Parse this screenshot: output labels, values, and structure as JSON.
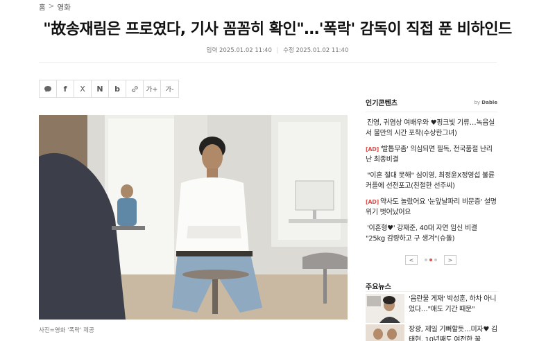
{
  "breadcrumb": {
    "home": "홈",
    "sep": ">",
    "section": "영화"
  },
  "headline": "\"故송재림은 프로였다, 기사 꼼꼼히 확인\"…'폭락' 감독이 직접 푼 비하인드",
  "meta": {
    "input": "입력 2025.01.02 11:40",
    "divider": "|",
    "updated": "수정 2025.01.02 11:40"
  },
  "share": {
    "comment_icon": "speech-bubble",
    "facebook": "f",
    "x": "X",
    "naver": "N",
    "band": "b",
    "link_icon": "link",
    "font_up": "가+",
    "font_down": "가-"
  },
  "photo_caption": "사진=영화 '폭락' 제공",
  "popular": {
    "title": "인기콘텐츠",
    "by": "by",
    "provider": "Dable",
    "items": [
      {
        "ad": "",
        "text": "진영, 귀염상 여배우와 ♥핑크빛 기류…녹음실서 물만의 시간 포착(수상한그녀)"
      },
      {
        "ad": "[AD]",
        "text": "'발톱무좀' 의심되면 필독, 전국품절 난리난 최종비결"
      },
      {
        "ad": "",
        "text": "\"이혼 절대 못해\" 심이영, 최정윤X정영섭 불륜 커플에 선전포고(친절한 선주씨)"
      },
      {
        "ad": "[AD]",
        "text": "약사도 놀랐어요 '눈앞날파리 비문증' 설명위기 벗어났어요"
      },
      {
        "ad": "",
        "text": "'이혼형♥' 강재준, 40대 자연 임신 비결 \"25kg 감량하고 구 생겨\"(슈돌)"
      }
    ],
    "prev": "<",
    "next": ">"
  },
  "main_news": {
    "title": "주요뉴스",
    "items": [
      {
        "text": "'음란물 게재' 박성훈, 하차 아니었다…\"애도 기간 때문\""
      },
      {
        "text": "장광, 제일 기뻐할듯…미자♥ 김태현, 10년째도 여전한 꿀"
      }
    ]
  },
  "colors": {
    "accent": "#d9534f",
    "text": "#111111",
    "muted": "#777777"
  }
}
